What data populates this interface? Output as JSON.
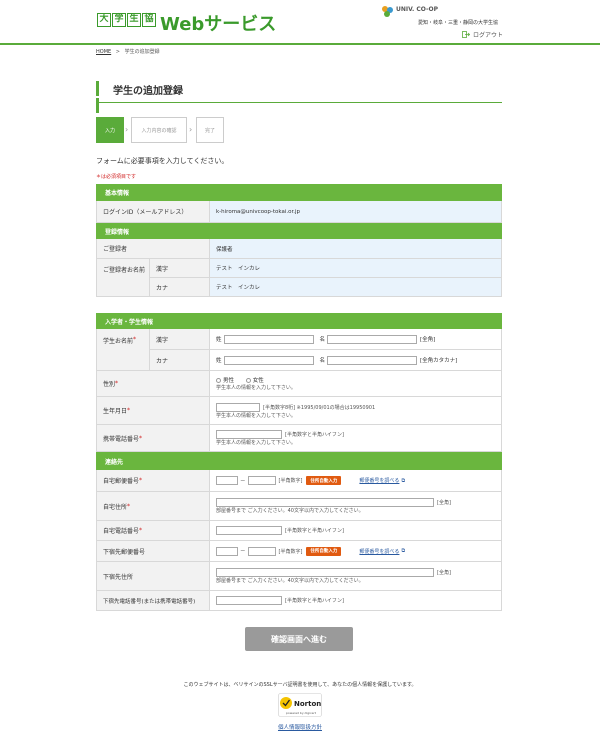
{
  "header": {
    "logo_chars": [
      "大",
      "学",
      "生",
      "協"
    ],
    "logo_web": "Webサービス",
    "region_logo_text": "UNIV. CO-OP",
    "region_text": "愛知・岐阜・三重・静岡の大学生協",
    "logout": "ログアウト"
  },
  "breadcrumb": {
    "home": "HOME",
    "sep": ">",
    "current": "学生の追加登録"
  },
  "page_title": "学生の追加登録",
  "steps": [
    "入力",
    "入力内容の確認",
    "完了"
  ],
  "intro": "フォームに必要事項を入力してください。",
  "required_note": "＊は必須項目です",
  "basic": {
    "section": "基本情報",
    "login_label": "ログインID（メールアドレス）",
    "login_value": "k-hiroma@univcoop-tokai.or.jp"
  },
  "registration": {
    "section": "登録情報",
    "registrant_label": "ご登録者",
    "registrant_value": "保護者",
    "name_label": "ご登録者お名前",
    "kanji_label": "漢字",
    "kanji_value": "テスト　インカレ",
    "kana_label": "カナ",
    "kana_value": "テスト　インカレ"
  },
  "student": {
    "section": "入学者・学生情報",
    "name_label": "学生お名前",
    "kanji_label": "漢字",
    "kana_label": "カナ",
    "sei": "姓",
    "mei": "名",
    "zenkaku": "[全角]",
    "zenkaku_kana": "[全角カタカナ]",
    "gender_label": "性別",
    "male": "男性",
    "female": "女性",
    "self_note": "学生本人の情報を入力して下さい。",
    "birth_label": "生年月日",
    "birth_hint": "[半角数字8桁] ※1995/09/01の場合は19950901",
    "phone_label": "携帯電話番号",
    "phone_hint": "[半角数字と半角ハイフン]"
  },
  "contact": {
    "section": "連絡先",
    "zip_label": "自宅郵便番号",
    "dash": "－",
    "half_digit": "[半角数字]",
    "auto_fill": "住所自動入力",
    "zip_lookup": "郵便番号を調べる",
    "address_label": "自宅住所",
    "address_hint": "[全角]",
    "address_note": "部屋番号まで ご入力ください。40文字以内で入力してください。",
    "home_phone_label": "自宅電話番号",
    "phone_hint": "[半角数字と半角ハイフン]",
    "lodging_zip_label": "下宿先郵便番号",
    "lodging_address_label": "下宿先住所",
    "lodging_phone_label": "下宿先電話番号(または携帯電話番号)"
  },
  "submit": "確認画面へ進む",
  "ssl_text": "このウェブサイトは、ベリサインのSSLサーバ証明書を使用して、あなたの個人情報を保護しています。",
  "norton": {
    "brand": "Norton",
    "powered": "powered by digicert"
  },
  "privacy": "個人情報取扱方針",
  "colors": {
    "green": "#5aab3a",
    "orange": "#e05a10",
    "required": "#d02020"
  }
}
